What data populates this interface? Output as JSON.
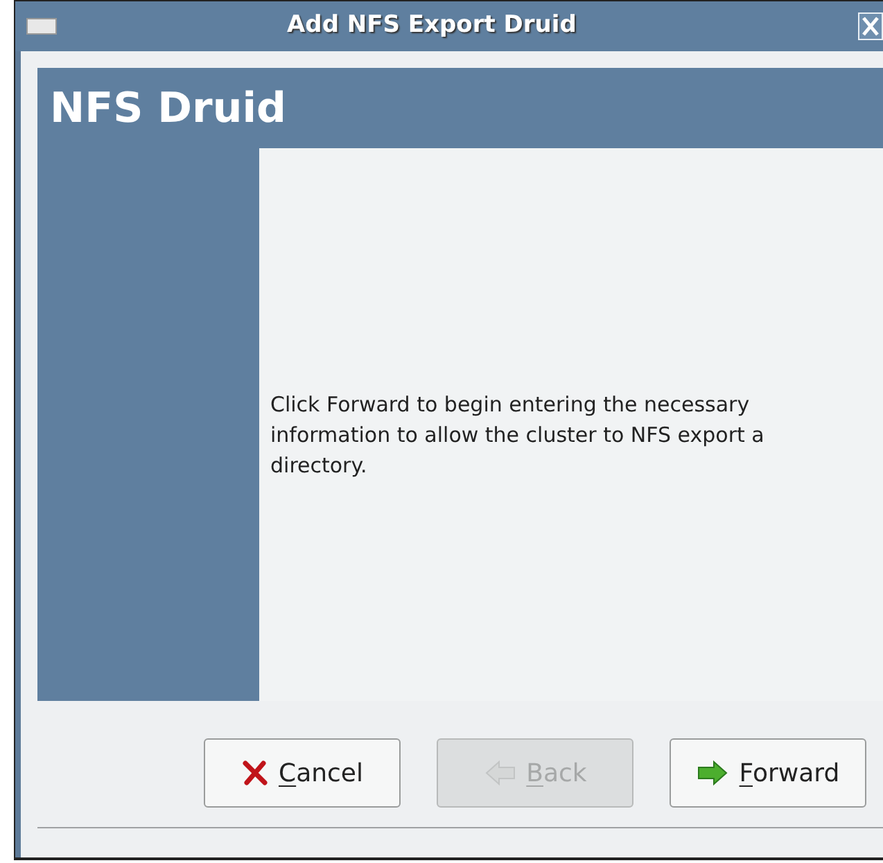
{
  "window": {
    "title": "Add NFS Export Druid"
  },
  "header": {
    "title": "NFS Druid"
  },
  "body": {
    "text": "Click Forward to begin entering the necessary information to allow the cluster to NFS export a directory."
  },
  "buttons": [
    {
      "label": "Cancel",
      "kind": "cancel",
      "disabled": false
    },
    {
      "label": "Back",
      "kind": "back",
      "disabled": true
    },
    {
      "label": "Forward",
      "kind": "forward",
      "disabled": false
    }
  ]
}
